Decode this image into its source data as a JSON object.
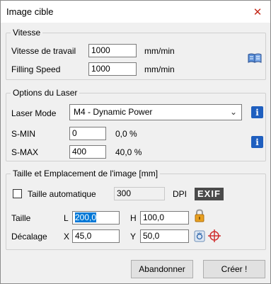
{
  "window": {
    "title": "Image cible",
    "close_glyph": "✕"
  },
  "speed_group": {
    "legend": "Vitesse",
    "work_speed_label": "Vitesse de travail",
    "work_speed_value": "1000",
    "work_speed_unit": "mm/min",
    "filling_speed_label": "Filling Speed",
    "filling_speed_value": "1000",
    "filling_speed_unit": "mm/min",
    "book_icon": "book-icon"
  },
  "laser_group": {
    "legend": "Options du Laser",
    "mode_label": "Laser Mode",
    "mode_value": "M4 - Dynamic Power",
    "smin_label": "S-MIN",
    "smin_value": "0",
    "smin_percent": "0,0 %",
    "smax_label": "S-MAX",
    "smax_value": "400",
    "smax_percent": "40,0 %",
    "info_glyph": "i"
  },
  "image_group": {
    "legend": "Taille et Emplacement de l'image [mm]",
    "auto_size_label": "Taille automatique",
    "auto_size_checked": false,
    "dpi_value": "300",
    "dpi_label": "DPI",
    "exif_label": "EXIF",
    "size_label": "Taille",
    "l_label": "L",
    "l_value": "200,0",
    "h_label": "H",
    "h_value": "100,0",
    "offset_label": "Décalage",
    "x_label": "X",
    "x_value": "45,0",
    "y_label": "Y",
    "y_value": "50,0"
  },
  "buttons": {
    "cancel_label": "Abandonner",
    "create_label": "Créer !"
  },
  "colors": {
    "accent": "#1f5fbf",
    "selection": "#0078d7",
    "lock": "#e8a020",
    "target": "#d03030"
  }
}
